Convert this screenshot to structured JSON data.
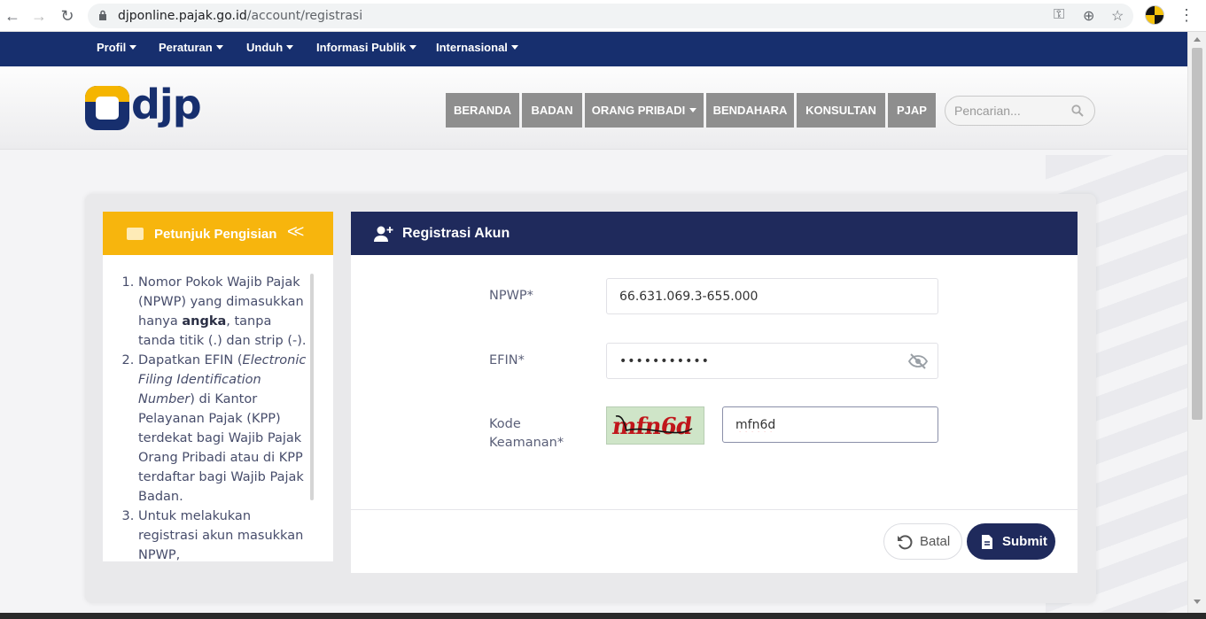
{
  "browser": {
    "url_host": "djponline.pajak.go.id",
    "url_path": "/account/registrasi"
  },
  "topnav": {
    "items": [
      "Profil",
      "Peraturan",
      "Unduh",
      "Informasi Publik",
      "Internasional"
    ]
  },
  "header": {
    "logo_text": "djp",
    "menu": [
      "BERANDA",
      "BADAN",
      "ORANG PRIBADI",
      "BENDAHARA",
      "KONSULTAN",
      "PJAP"
    ],
    "search_placeholder": "Pencarian..."
  },
  "guide": {
    "title": "Petunjuk Pengisian",
    "item1_a": "Nomor Pokok Wajib Pajak (NPWP) yang dimasukkan hanya ",
    "item1_b": "angka",
    "item1_c": ", tanpa tanda titik (.) dan strip (-).",
    "item2_a": "Dapatkan EFIN (",
    "item2_b": "Electronic Filing Identification Number",
    "item2_c": ") di Kantor Pelayanan Pajak (KPP) terdekat bagi Wajib Pajak Orang Pribadi atau di KPP terdaftar bagi Wajib Pajak Badan.",
    "item3": "Untuk melakukan registrasi akun masukkan NPWP,"
  },
  "form": {
    "title": "Registrasi Akun",
    "npwp_label": "NPWP*",
    "npwp_value": "66.631.069.3-655.000",
    "efin_label": "EFIN*",
    "efin_value": "•••••••••••",
    "kode_label_1": "Kode",
    "kode_label_2": "Keamanan*",
    "captcha_text": "mfn6d",
    "kode_value": "mfn6d",
    "batal_label": "Batal",
    "submit_label": "Submit"
  },
  "colors": {
    "navy": "#172f6e",
    "form_header": "#1f2a5c",
    "guide_header": "#f7b50d",
    "menu_button": "#8e8e8e"
  }
}
